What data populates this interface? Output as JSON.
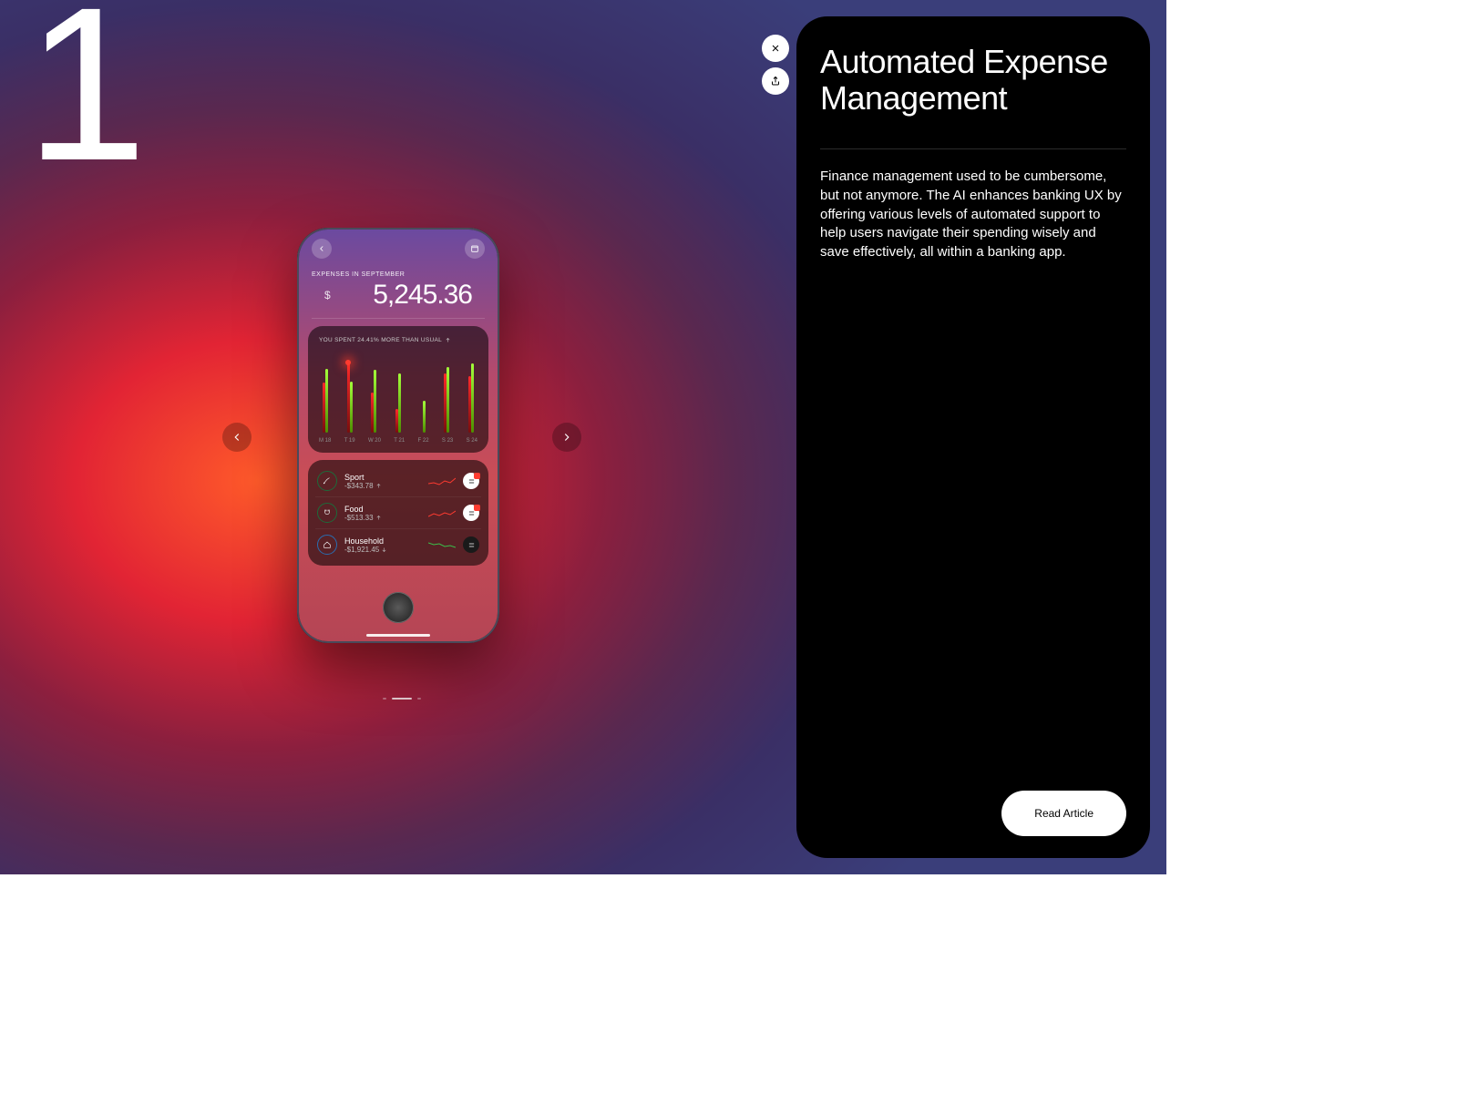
{
  "slide_number": "1",
  "panel": {
    "title": "Automated Expense Management",
    "body": "Finance management used to be cumbersome, but not anymore. The AI enhances banking UX by offering various levels of automated support to help users navigate their spending wisely and save effectively, all within a banking app.",
    "cta": "Read Article"
  },
  "phone": {
    "section_label": "EXPENSES IN SEPTEMBER",
    "currency": "$",
    "amount": "5,245.36",
    "insight": "YOU SPENT 24.41% MORE THAN USUAL",
    "categories": [
      {
        "name": "Sport",
        "amount": "-$343.78",
        "trend": "up",
        "badge": true
      },
      {
        "name": "Food",
        "amount": "-$513.33",
        "trend": "up",
        "badge": true
      },
      {
        "name": "Household",
        "amount": "-$1,921.45",
        "trend": "down",
        "badge": false
      }
    ]
  },
  "chart_data": {
    "type": "bar",
    "title": "YOU SPENT 24.41% MORE THAN USUAL",
    "categories": [
      "M 18",
      "T 19",
      "W 20",
      "T 21",
      "F 22",
      "S 23",
      "S 24"
    ],
    "series": [
      {
        "name": "red",
        "values": [
          62,
          88,
          50,
          30,
          0,
          74,
          70
        ]
      },
      {
        "name": "green",
        "values": [
          80,
          64,
          78,
          74,
          40,
          82,
          86
        ]
      }
    ],
    "highlight_index": 1,
    "ylim": [
      0,
      100
    ]
  }
}
